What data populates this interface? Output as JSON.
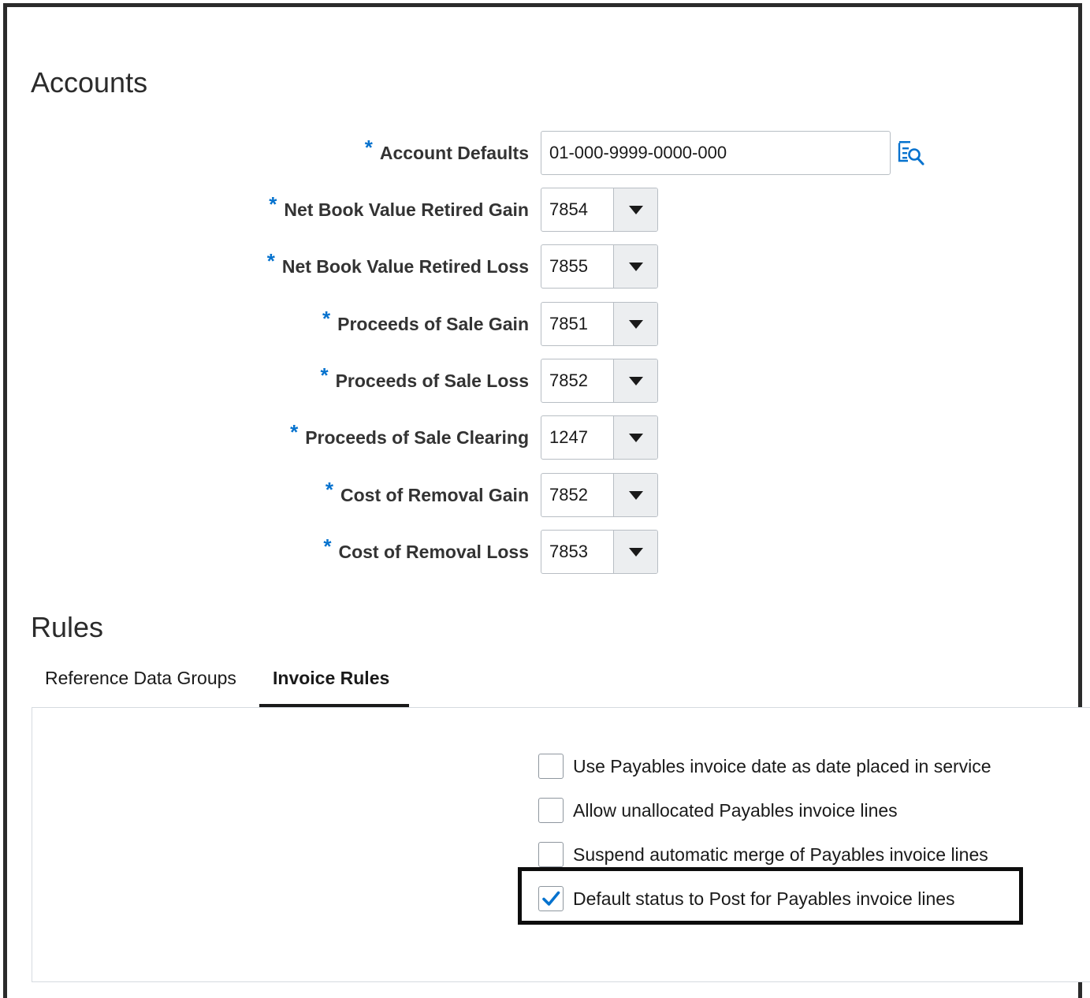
{
  "accounts": {
    "title": "Accounts",
    "required_marker": "*",
    "account_defaults": {
      "label": "Account Defaults",
      "value": "01-000-9999-0000-000"
    },
    "fields": [
      {
        "label": "Net Book Value Retired Gain",
        "value": "7854"
      },
      {
        "label": "Net Book Value Retired Loss",
        "value": "7855"
      },
      {
        "label": "Proceeds of Sale Gain",
        "value": "7851"
      },
      {
        "label": "Proceeds of Sale Loss",
        "value": "7852"
      },
      {
        "label": "Proceeds of Sale Clearing",
        "value": "1247"
      },
      {
        "label": "Cost of Removal Gain",
        "value": "7852"
      },
      {
        "label": "Cost of Removal Loss",
        "value": "7853"
      }
    ]
  },
  "rules": {
    "title": "Rules",
    "tabs": [
      {
        "label": "Reference Data Groups",
        "selected": false
      },
      {
        "label": "Invoice Rules",
        "selected": true
      }
    ],
    "invoice_rules": [
      {
        "label": "Use Payables invoice date as date placed in service",
        "checked": false
      },
      {
        "label": "Allow unallocated Payables invoice lines",
        "checked": false
      },
      {
        "label": "Suspend automatic merge of Payables invoice lines",
        "checked": false
      },
      {
        "label": "Default status to Post for Payables invoice lines",
        "checked": true,
        "highlighted": true
      }
    ]
  },
  "colors": {
    "required_asterisk": "#0572ce",
    "checkmark": "#0572ce",
    "search_icon": "#0572ce",
    "highlight_border": "#0d0d0d"
  },
  "icons": {
    "account_search": "search-icon",
    "dropdown": "chevron-down-icon",
    "check": "checkmark-icon"
  }
}
